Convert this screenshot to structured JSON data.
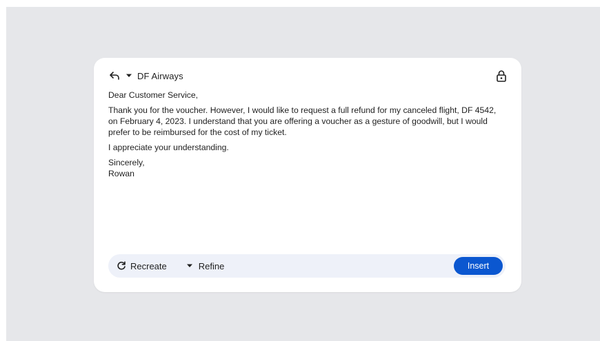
{
  "header": {
    "recipient": "DF Airways"
  },
  "message": {
    "greeting": "Dear Customer Service,",
    "paragraph_1": "Thank you for the voucher. However, I would like to request a full refund for my canceled flight, DF 4542, on February 4, 2023. I understand that you are offering a voucher as a gesture of goodwill, but I would prefer to be reimbursed for the cost of my ticket.",
    "paragraph_2": "I appreciate your understanding.",
    "closing": "Sincerely,",
    "signature": "Rowan"
  },
  "toolbar": {
    "recreate_label": "Recreate",
    "refine_label": "Refine",
    "insert_label": "Insert"
  },
  "colors": {
    "backdrop": "#e6e7ea",
    "card": "#ffffff",
    "toolbar": "#eef1f9",
    "accent": "#0b57d0"
  },
  "icons": {
    "reply": "reply-arrow-icon",
    "dropdown": "caret-down-icon",
    "lock": "lock-icon",
    "recreate": "refresh-icon",
    "refine": "caret-down-icon"
  }
}
